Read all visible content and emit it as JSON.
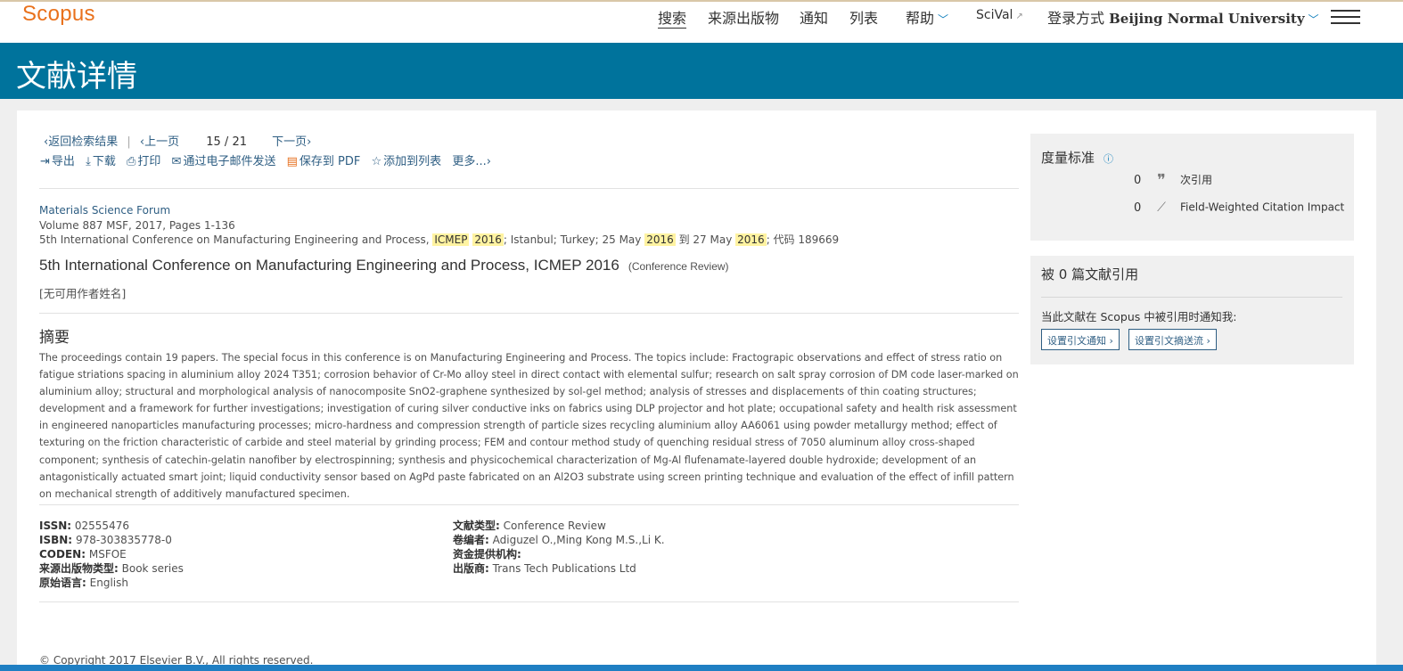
{
  "app": {
    "logo": "Scopus"
  },
  "nav": {
    "search": "搜索",
    "sources": "来源出版物",
    "alerts": "通知",
    "lists": "列表",
    "help": "帮助",
    "scival": "SciVal",
    "login_prefix": "登录方式",
    "institution": "Beijing Normal University"
  },
  "banner": {
    "title": "文献详情"
  },
  "doc_nav": {
    "back": "返回检索结果",
    "prev": "上一页",
    "current": "15",
    "total": "21",
    "next": "下一页",
    "tools": {
      "export": "导出",
      "download": "下载",
      "print": "打印",
      "email": "通过电子邮件发送",
      "save_pdf": "保存到 PDF",
      "add_list": "添加到列表",
      "more": "更多..."
    }
  },
  "source": {
    "journal": "Materials Science Forum",
    "volume": "Volume 887 MSF, 2017, Pages 1-136",
    "conf_prefix": "5th International Conference on Manufacturing Engineering and Process,",
    "hl1": "ICMEP",
    "hl2": "2016",
    "conf_mid": "; Istanbul; Turkey; 25 May",
    "hl3": "2016",
    "conf_to": "到 27 May",
    "hl4": "2016",
    "conf_code": "; 代码 189669"
  },
  "title": {
    "text": "5th International Conference on Manufacturing Engineering and Process, ICMEP 2016",
    "type": "(Conference Review)"
  },
  "no_author": "[无可用作者姓名]",
  "abstract": {
    "heading": "摘要",
    "text": "The proceedings contain 19 papers. The special focus in this conference is on Manufacturing Engineering and Process. The topics include: Fractograpic observations and effect of stress ratio on fatigue striations spacing in aluminium alloy 2024 T351; corrosion behavior of Cr-Mo alloy steel in direct contact with elemental sulfur; research on salt spray corrosion of DM code laser-marked on aluminium alloy; structural and morphological analysis of nanocomposite SnO2-graphene synthesized by sol-gel method; analysis of stresses and displacements of thin coating structures; development and a framework for further investigations; investigation of curing silver conductive inks on fabrics using DLP projector and hot plate; occupational safety and health risk assessment in engineered nanoparticles manufacturing processes; micro-hardness and compression strength of particle sizes recycling aluminium alloy AA6061 using powder metallurgy method; effect of texturing on the friction characteristic of carbide and steel material by grinding process; FEM and contour method study of quenching residual stress of 7050 aluminum alloy cross-shaped component; synthesis of catechin-gelatin nanofiber by electrospinning; synthesis and physicochemical characterization of Mg-Al flufenamate-layered double hydroxide; development of an antagonistically actuated smart joint; liquid conductivity sensor based on AgPd paste fabricated on an Al2O3 substrate using screen printing technique and evaluation of the effect of infill pattern on mechanical strength of additively manufactured specimen."
  },
  "meta_left": [
    {
      "k": "ISSN:",
      "v": "02555476"
    },
    {
      "k": "ISBN:",
      "v": "978-303835778-0"
    },
    {
      "k": "CODEN:",
      "v": "MSFOE"
    },
    {
      "k": "来源出版物类型:",
      "v": "Book series"
    },
    {
      "k": "原始语言:",
      "v": "English"
    }
  ],
  "meta_right": [
    {
      "k": "文献类型:",
      "v": "Conference Review"
    },
    {
      "k": "卷编者:",
      "v": "Adiguzel O.,Ming Kong M.S.,Li K."
    },
    {
      "k": "资金提供机构:",
      "v": ""
    },
    {
      "k": "出版商:",
      "v": "Trans Tech Publications Ltd"
    }
  ],
  "copyright": "© Copyright 2017 Elsevier B.V., All rights reserved.",
  "metrics": {
    "heading": "度量标准",
    "citations_value": "0",
    "citations_label": "次引用",
    "fwci_value": "0",
    "fwci_label": "Field-Weighted Citation Impact"
  },
  "cited_by": {
    "heading": "被 0 篇文献引用",
    "notify": "当此文献在 Scopus 中被引用时通知我:",
    "alert_btn": "设置引文通知 ›",
    "feed_btn": "设置引文摘送流 ›"
  }
}
